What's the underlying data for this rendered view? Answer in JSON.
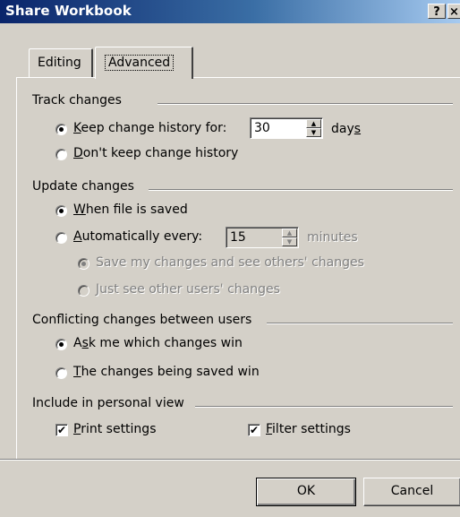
{
  "window": {
    "title": "Share Workbook",
    "help_label": "?",
    "close_label": "×"
  },
  "tabs": [
    {
      "label": "Editing",
      "active": false
    },
    {
      "label": "Advanced",
      "active": true
    }
  ],
  "track_changes": {
    "heading": "Track changes",
    "keep_history": {
      "access_key": "K",
      "label_rest": "eep change history for:",
      "selected": true,
      "days_value": "30",
      "unit_pre": "day",
      "unit_access": "s"
    },
    "dont_keep": {
      "access_key": "D",
      "label_rest": "on't keep change history",
      "selected": false
    }
  },
  "update_changes": {
    "heading": "Update changes",
    "when_saved": {
      "access_key": "W",
      "label_rest": "hen file is saved",
      "selected": true
    },
    "automatically": {
      "access_key": "A",
      "label_rest": "utomatically every:",
      "selected": false,
      "minutes_value": "15",
      "unit": "minutes"
    },
    "save_and_see": {
      "label": "Save my changes and see others' changes",
      "selected": true,
      "enabled": false
    },
    "just_see": {
      "label": "Just see other users' changes",
      "selected": false,
      "enabled": false
    }
  },
  "conflicts": {
    "heading": "Conflicting changes between users",
    "ask_me": {
      "pre": "A",
      "access_key": "s",
      "label_rest": "k me which changes win",
      "selected": true
    },
    "saved_win": {
      "access_key": "T",
      "label_rest": "he changes being saved win",
      "selected": false
    }
  },
  "personal_view": {
    "heading": "Include in personal view",
    "print_settings": {
      "access_key": "P",
      "label_rest": "rint settings",
      "checked": true
    },
    "filter_settings": {
      "access_key": "F",
      "label_rest": "ilter settings",
      "checked": true
    }
  },
  "buttons": {
    "ok": "OK",
    "cancel": "Cancel"
  },
  "icons": {
    "check_glyph": "✔",
    "spin_up_glyph": "▲",
    "spin_down_glyph": "▼"
  }
}
